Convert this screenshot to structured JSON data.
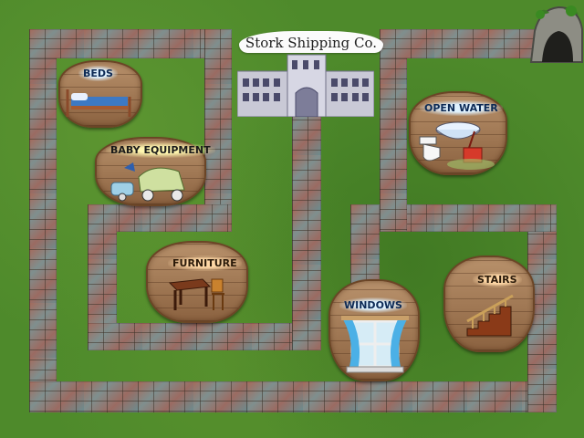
{
  "company": {
    "name": "Stork Shipping Co."
  },
  "rooms": [
    {
      "label": "BEDS",
      "icon": "bed-icon"
    },
    {
      "label": "BABY EQUIPMENT",
      "icon": "stroller-icon"
    },
    {
      "label": "FURNITURE",
      "icon": "table-chair-icon"
    },
    {
      "label": "OPEN WATER",
      "icon": "tub-toilet-icon"
    },
    {
      "label": "STAIRS",
      "icon": "stairs-icon"
    },
    {
      "label": "WINDOWS",
      "icon": "window-icon"
    }
  ],
  "decor": {
    "cave": "cave-icon",
    "building": "building-icon"
  }
}
